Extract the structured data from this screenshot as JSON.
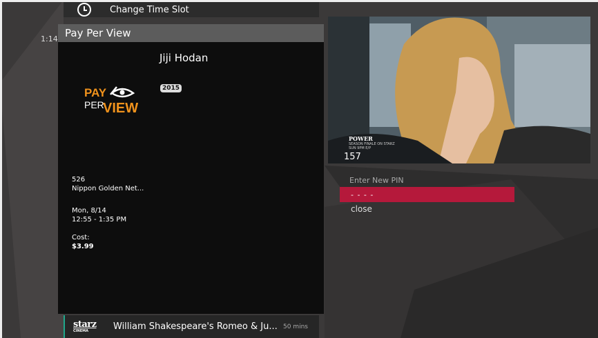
{
  "top_row": {
    "label": "Change Time Slot",
    "icon": "clock-icon"
  },
  "time_left": "1:14",
  "panel": {
    "header": "Pay Per View",
    "program_title": "Jiji Hodan",
    "year": "2015",
    "logo": {
      "top": "PAY",
      "bottom_left": "PER",
      "bottom_right": "VIEW"
    },
    "channel_number": "526",
    "channel_name": "Nippon Golden Net...",
    "date": "Mon, 8/14",
    "time_range": "12:55 - 1:35 PM",
    "cost_label": "Cost:",
    "cost_value": "$3.99"
  },
  "video": {
    "brand": "POWER",
    "promo_line1": "SEASON FINALE ON STARZ",
    "promo_line2": "SUN 9PM E/P",
    "channel": "157"
  },
  "pin": {
    "label": "Enter New PIN",
    "value": "- - - -",
    "close_label": "close"
  },
  "bottom_row": {
    "network_logo": "starz",
    "network_sub": "CINEMA",
    "title": "William Shakespeare's Romeo & Ju...",
    "duration": "50 mins"
  },
  "colors": {
    "accent": "#b5193b",
    "highlight": "#1fa88c",
    "ppv_orange": "#f0921c"
  }
}
